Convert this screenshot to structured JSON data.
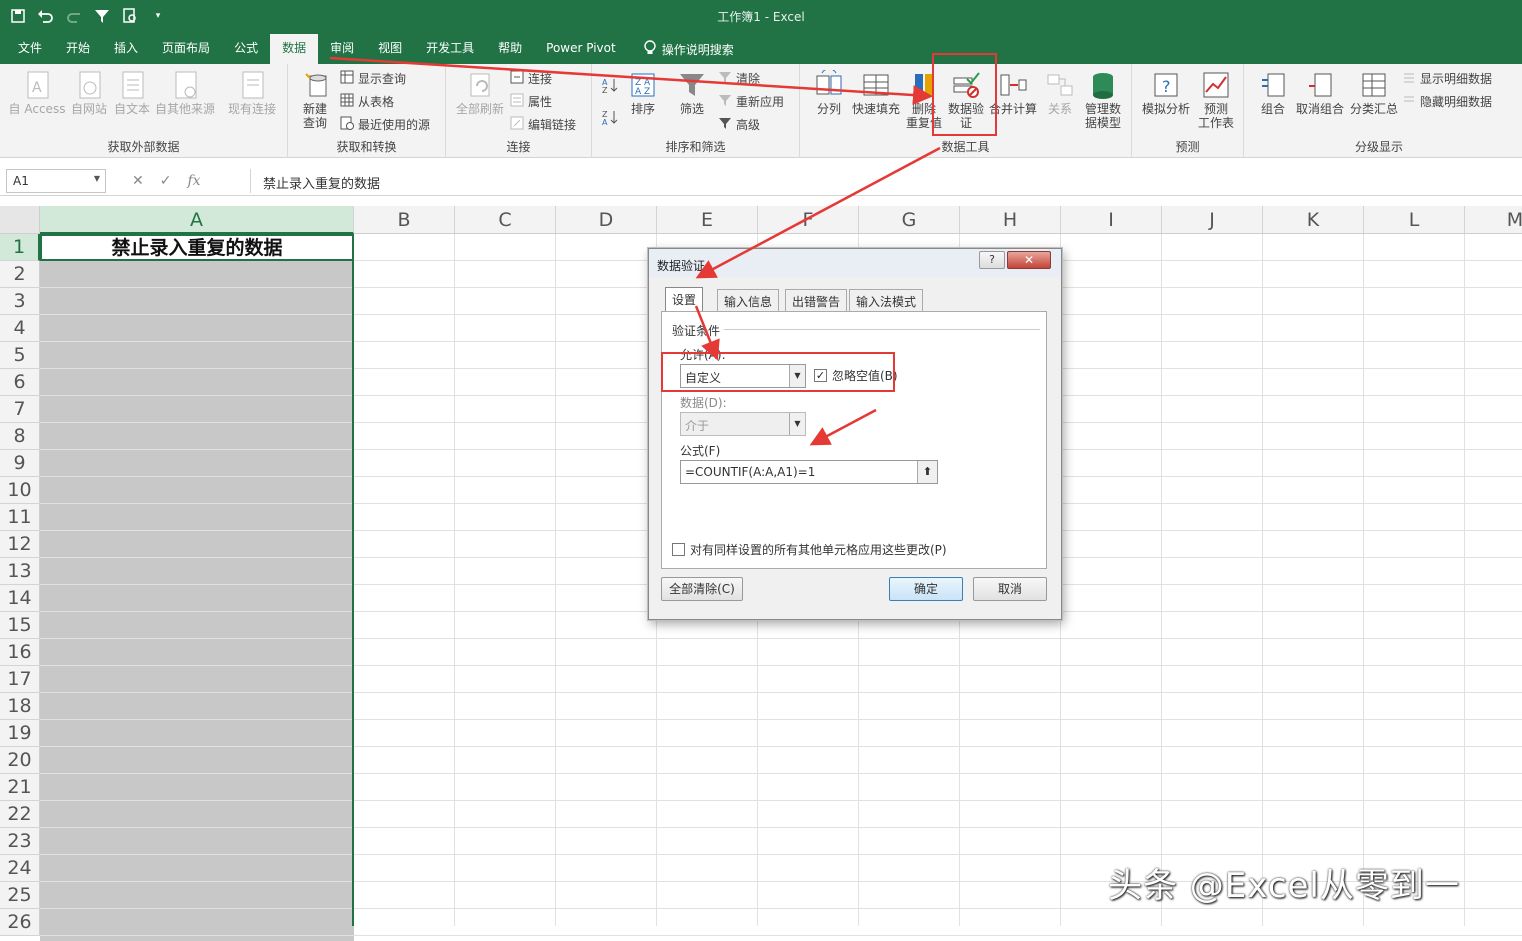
{
  "window": {
    "title": "工作簿1  -  Excel"
  },
  "tabs": [
    "文件",
    "开始",
    "插入",
    "页面布局",
    "公式",
    "数据",
    "审阅",
    "视图",
    "开发工具",
    "帮助",
    "Power Pivot"
  ],
  "active_tab": "数据",
  "tell_me": "操作说明搜索",
  "ribbon": {
    "get_external": {
      "access": "自 Access",
      "web": "自网站",
      "text": "自文本",
      "other": "自其他来源",
      "existing": "现有连接",
      "label": "获取外部数据"
    },
    "get_transform": {
      "new_query_1": "新建",
      "new_query_2": "查询",
      "show_query": "显示查询",
      "from_table": "从表格",
      "recent": "最近使用的源",
      "label": "获取和转换"
    },
    "connections": {
      "refresh_all": "全部刷新",
      "connections": "连接",
      "properties": "属性",
      "edit_links": "编辑链接",
      "label": "连接"
    },
    "sort_filter": {
      "sort": "排序",
      "filter": "筛选",
      "clear": "清除",
      "reapply": "重新应用",
      "advanced": "高级",
      "label": "排序和筛选"
    },
    "data_tools": {
      "split": "分列",
      "flash_fill": "快速填充",
      "remove_dup_1": "删除",
      "remove_dup_2": "重复值",
      "validation_1": "数据验",
      "validation_2": "证",
      "consolidate": "合并计算",
      "relations": "关系",
      "manage_model_1": "管理数",
      "manage_model_2": "据模型",
      "label": "数据工具"
    },
    "forecast": {
      "what_if": "模拟分析",
      "forecast_1": "预测",
      "forecast_2": "工作表",
      "label": "预测"
    },
    "outline": {
      "group": "组合",
      "ungroup": "取消组合",
      "subtotal": "分类汇总",
      "show_detail": "显示明细数据",
      "hide_detail": "隐藏明细数据",
      "label": "分级显示"
    }
  },
  "formula_bar": {
    "name_box": "A1",
    "formula": "禁止录入重复的数据"
  },
  "columns": [
    "A",
    "B",
    "C",
    "D",
    "E",
    "F",
    "G",
    "H",
    "I",
    "J",
    "K",
    "L",
    "M"
  ],
  "rows": [
    "1",
    "2",
    "3",
    "4",
    "5",
    "6",
    "7",
    "8",
    "9",
    "10",
    "11",
    "12",
    "13",
    "14",
    "15",
    "16",
    "17",
    "18",
    "19",
    "20",
    "21",
    "22",
    "23",
    "24",
    "25",
    "26"
  ],
  "cell_a1": "禁止录入重复的数据",
  "dialog": {
    "title": "数据验证",
    "tabs": [
      "设置",
      "输入信息",
      "出错警告",
      "输入法模式"
    ],
    "criteria_label": "验证条件",
    "allow_label": "允许(A):",
    "allow_value": "自定义",
    "ignore_blank": "忽略空值(B)",
    "data_label": "数据(D):",
    "data_value": "介于",
    "formula_label": "公式(F)",
    "formula_value": "=COUNTIF(A:A,A1)=1",
    "apply_all": "对有同样设置的所有其他单元格应用这些更改(P)",
    "clear_all": "全部清除(C)",
    "ok": "确定",
    "cancel": "取消"
  },
  "watermark": "头条 @Excel从零到一",
  "colors": {
    "excel_green": "#217346",
    "annotation_red": "#e53935",
    "selection_fill": "#c8c8c8"
  }
}
